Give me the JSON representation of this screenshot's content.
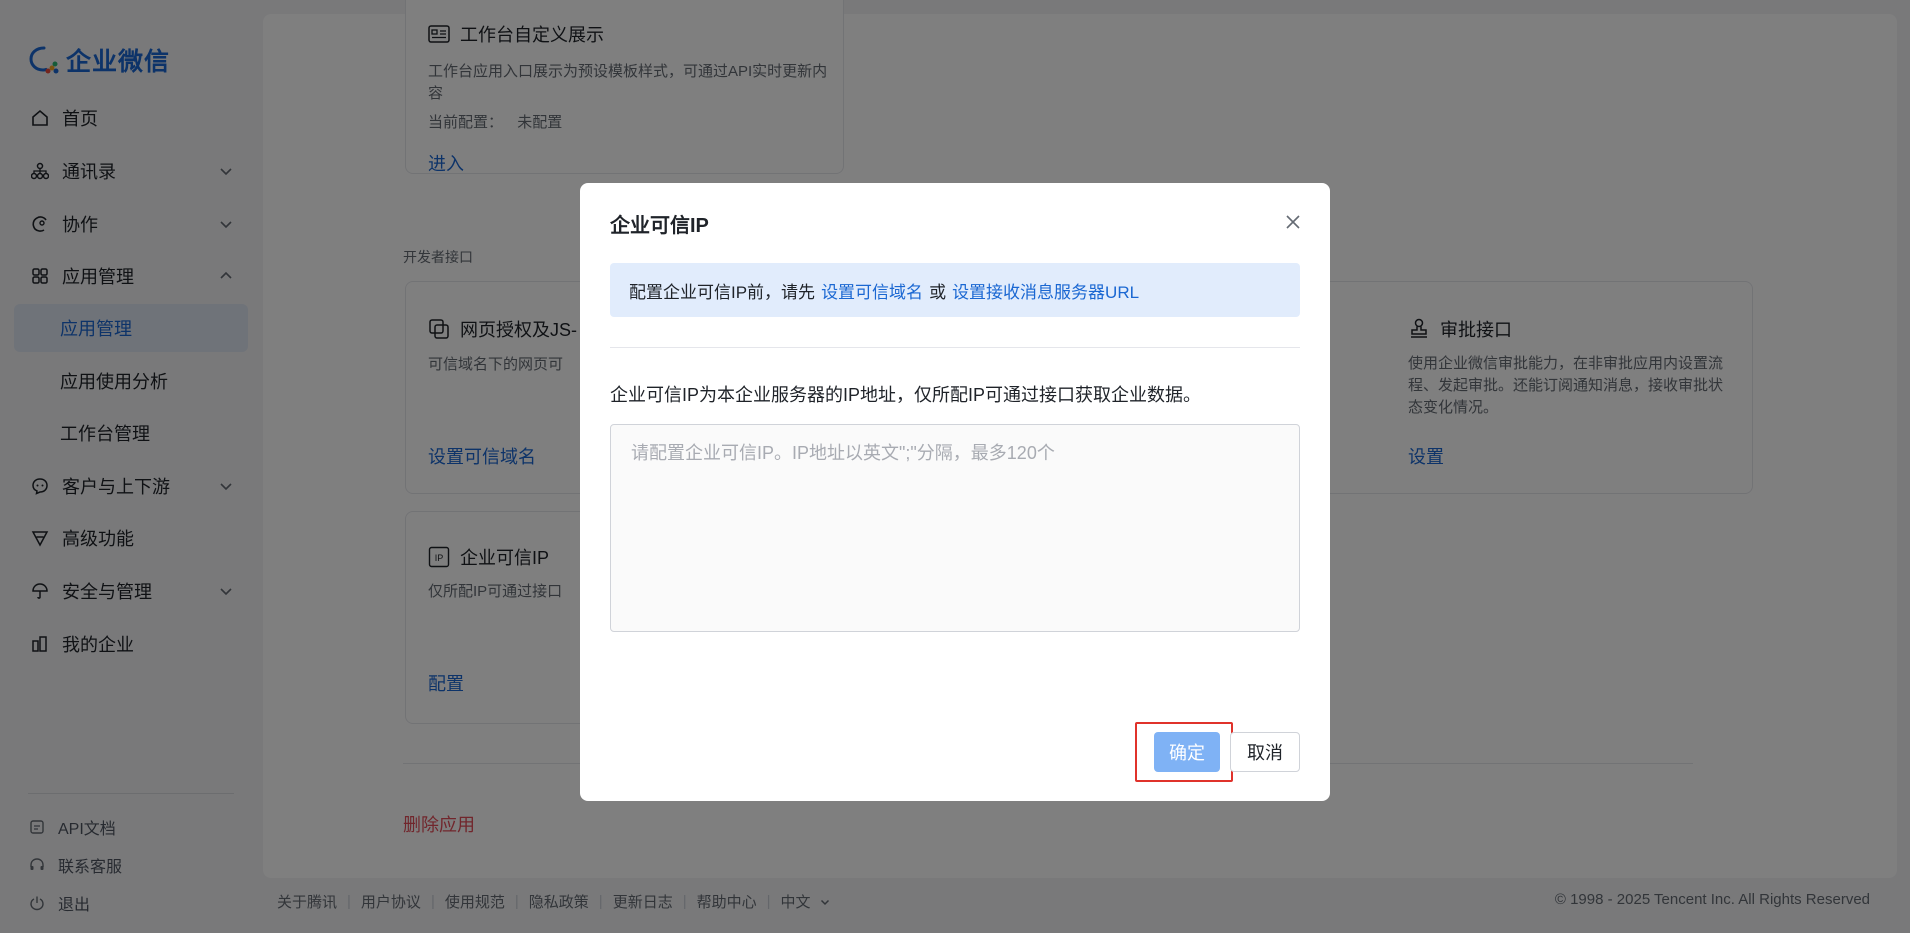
{
  "app": {
    "name": "企业微信"
  },
  "colors": {
    "accent": "#1a67d2",
    "danger": "#e34d59",
    "overlay": "rgba(0,0,0,0.5)",
    "highlight_box": "#e0322b"
  },
  "sidebar": {
    "items": [
      {
        "label": "首页",
        "icon": "home-icon"
      },
      {
        "label": "通讯录",
        "icon": "org-chart-icon",
        "expanded": false
      },
      {
        "label": "协作",
        "icon": "collaboration-icon",
        "expanded": false
      },
      {
        "label": "应用管理",
        "icon": "apps-grid-icon",
        "expanded": true
      }
    ],
    "sub_items": [
      {
        "label": "应用管理",
        "active": true
      },
      {
        "label": "应用使用分析"
      },
      {
        "label": "工作台管理"
      }
    ],
    "items_after": [
      {
        "label": "客户与上下游",
        "icon": "chat-bubble-icon"
      },
      {
        "label": "高级功能",
        "icon": "filter-funnel-icon"
      },
      {
        "label": "安全与管理",
        "icon": "umbrella-icon"
      },
      {
        "label": "我的企业",
        "icon": "buildings-icon"
      }
    ],
    "footer": [
      {
        "label": "API文档",
        "icon": "doc-icon"
      },
      {
        "label": "联系客服",
        "icon": "headset-icon"
      },
      {
        "label": "退出",
        "icon": "power-icon"
      }
    ]
  },
  "main": {
    "workbench_card": {
      "title": "工作台自定义展示",
      "desc": "工作台应用入口展示为预设模板样式，可通过API实时更新内容",
      "config_label": "当前配置：",
      "config_value": "未配置",
      "link": "进入"
    },
    "section_label": "开发者接口",
    "web_auth_card": {
      "title": "网页授权及JS-",
      "desc": "可信域名下的网页可",
      "link": "设置可信域名"
    },
    "trusted_ip_card": {
      "title": "企业可信IP",
      "desc": "仅所配IP可通过接口",
      "link": "配置"
    },
    "approval_card": {
      "title": "审批接口",
      "desc": "使用企业微信审批能力，在非审批应用内设置流程、发起审批。还能订阅通知消息，接收审批状态变化情况。",
      "link": "设置"
    },
    "delete_link": "删除应用"
  },
  "footer": {
    "links": [
      "关于腾讯",
      "用户协议",
      "使用规范",
      "隐私政策",
      "更新日志",
      "帮助中心",
      "中文"
    ],
    "copyright": "© 1998 - 2025 Tencent Inc. All Rights Reserved"
  },
  "dialog": {
    "title": "企业可信IP",
    "notice_prefix": "配置企业可信IP前，请先",
    "notice_link1": "设置可信域名",
    "notice_or": "或",
    "notice_link2": "设置接收消息服务器URL",
    "description": "企业可信IP为本企业服务器的IP地址，仅所配IP可通过接口获取企业数据。",
    "textarea_placeholder": "请配置企业可信IP。IP地址以英文\";\"分隔，最多120个",
    "textarea_value": "",
    "confirm_label": "确定",
    "cancel_label": "取消"
  }
}
